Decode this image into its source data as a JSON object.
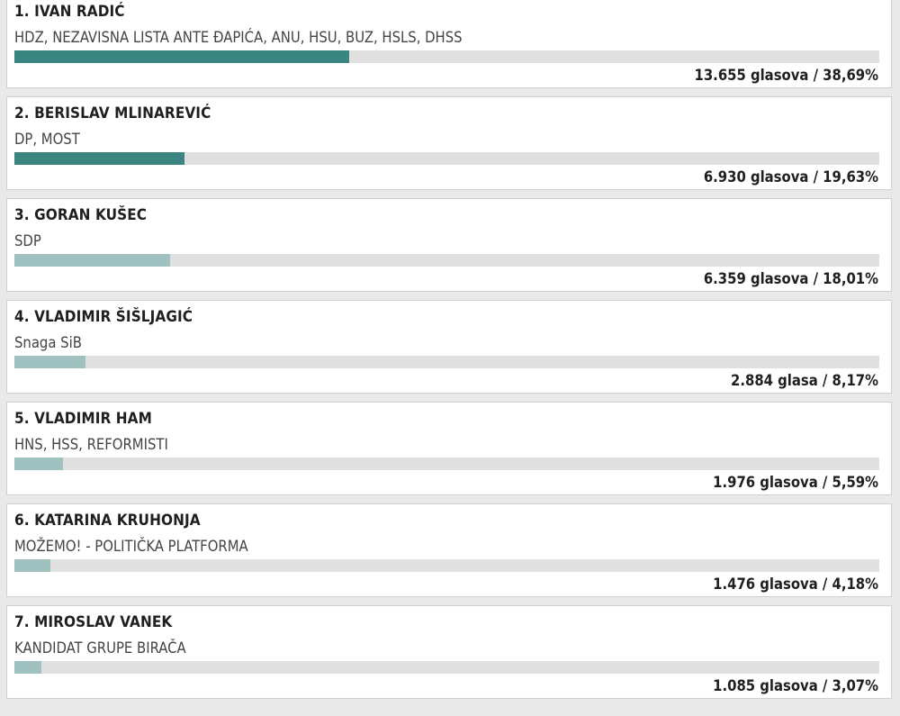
{
  "colors": {
    "leader_fill": "#3a8580",
    "other_fill": "#9fc2c1",
    "track": "#e0e0e0"
  },
  "candidates": [
    {
      "name": "1. IVAN RADIĆ",
      "party": "HDZ, NEZAVISNA LISTA ANTE ĐAPIĆA, ANU, HSU, BUZ, HSLS, DHSS",
      "votes": "13.655 glasova / 38,69%",
      "share": 38.69,
      "highlight": true
    },
    {
      "name": "2. BERISLAV MLINAREVIĆ",
      "party": "DP, MOST",
      "votes": "6.930 glasova / 19,63%",
      "share": 19.63,
      "highlight": true
    },
    {
      "name": "3. GORAN KUŠEC",
      "party": "SDP",
      "votes": "6.359 glasova / 18,01%",
      "share": 18.01,
      "highlight": false
    },
    {
      "name": "4. VLADIMIR ŠIŠLJAGIĆ",
      "party": "Snaga SiB",
      "votes": "2.884 glasa / 8,17%",
      "share": 8.17,
      "highlight": false
    },
    {
      "name": "5. VLADIMIR HAM",
      "party": "HNS, HSS, REFORMISTI",
      "votes": "1.976 glasova / 5,59%",
      "share": 5.59,
      "highlight": false
    },
    {
      "name": "6. KATARINA KRUHONJA",
      "party": "MOŽEMO! - POLITIČKA PLATFORMA",
      "votes": "1.476 glasova / 4,18%",
      "share": 4.18,
      "highlight": false
    },
    {
      "name": "7. MIROSLAV VANEK",
      "party": "KANDIDAT GRUPE BIRAČA",
      "votes": "1.085 glasova / 3,07%",
      "share": 3.07,
      "highlight": false
    }
  ]
}
